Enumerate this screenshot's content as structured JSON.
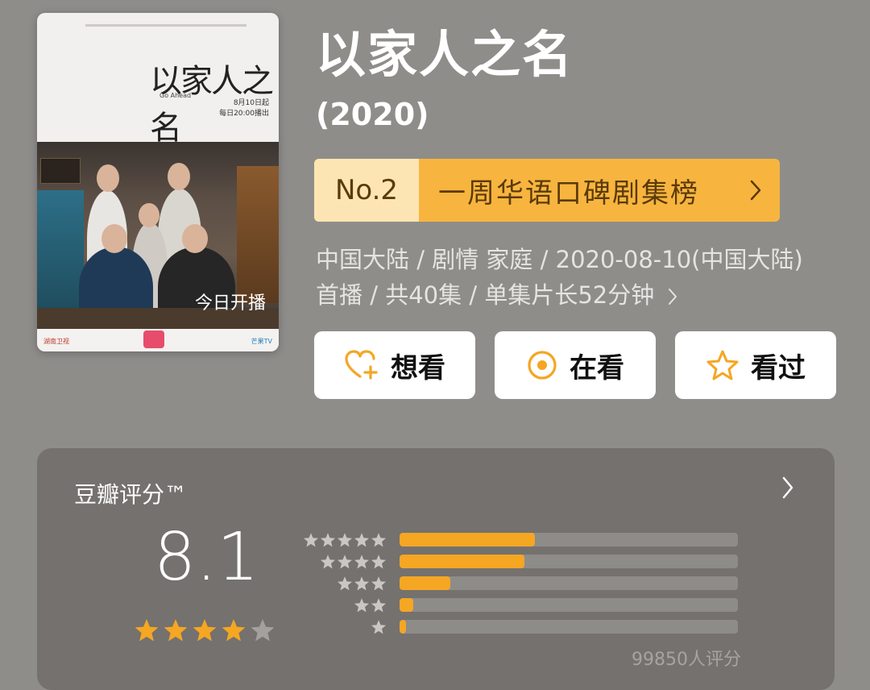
{
  "poster": {
    "calligraphy_title": "以家人之名",
    "english_subtitle": "Go Ahead",
    "date_text": "8月10日起",
    "time_text": "每日20:00播出",
    "overlay_text": "今日开播",
    "sign_text": "一品",
    "logo_left": "湖南卫视",
    "logo_right": "芒果TV"
  },
  "header": {
    "title": "以家人之名",
    "year": "(2020)"
  },
  "ranking": {
    "rank": "No.2",
    "list_name": "一周华语口碑剧集榜",
    "chevron_icon": "chevron-right-icon"
  },
  "meta": {
    "text": "中国大陆 / 剧情 家庭 / 2020-08-10(中国大陆)首播 / 共40集 / 单集片长52分钟"
  },
  "actions": [
    {
      "label": "想看",
      "icon": "heart-plus-icon",
      "color": "#f5a623"
    },
    {
      "label": "在看",
      "icon": "target-circle-icon",
      "color": "#f5a623"
    },
    {
      "label": "看过",
      "icon": "star-outline-icon",
      "color": "#f5a623"
    }
  ],
  "rating": {
    "title": "豆瓣评分™",
    "score": "8.1",
    "score_stars": 4,
    "count": "99850人评分",
    "distribution": [
      {
        "stars": 5,
        "fraction": 0.4
      },
      {
        "stars": 4,
        "fraction": 0.37
      },
      {
        "stars": 3,
        "fraction": 0.15
      },
      {
        "stars": 2,
        "fraction": 0.04
      },
      {
        "stars": 1,
        "fraction": 0.02
      }
    ]
  },
  "colors": {
    "accent": "#f5a623",
    "background": "#8f8d8a",
    "card": "#74716e"
  }
}
